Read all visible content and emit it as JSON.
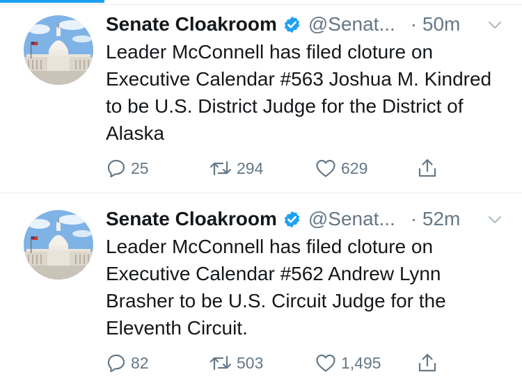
{
  "tweets": [
    {
      "name": "Senate Cloakroom",
      "handle": "@Senat...",
      "time": "· 50m",
      "text": "Leader McConnell has filed cloture on Executive Calendar #563 Joshua M. Kindred to be U.S. District Judge for the District of Alaska",
      "replies": "25",
      "retweets": "294",
      "likes": "629"
    },
    {
      "name": "Senate Cloakroom",
      "handle": "@Senat...",
      "time": "· 52m",
      "text": "Leader McConnell has filed cloture on Executive Calendar #562 Andrew Lynn Brasher to be U.S. Circuit Judge for the Eleventh Circuit.",
      "replies": "82",
      "retweets": "503",
      "likes": "1,495"
    }
  ],
  "icons": {
    "verified": "verified-badge-icon",
    "menu": "chevron-down-icon",
    "reply": "reply-icon",
    "retweet": "retweet-icon",
    "like": "heart-icon",
    "share": "share-icon"
  },
  "colors": {
    "accent": "#1da1f2",
    "secondary_text": "#657786",
    "primary_text": "#14171a",
    "divider": "#e6ecf0"
  }
}
